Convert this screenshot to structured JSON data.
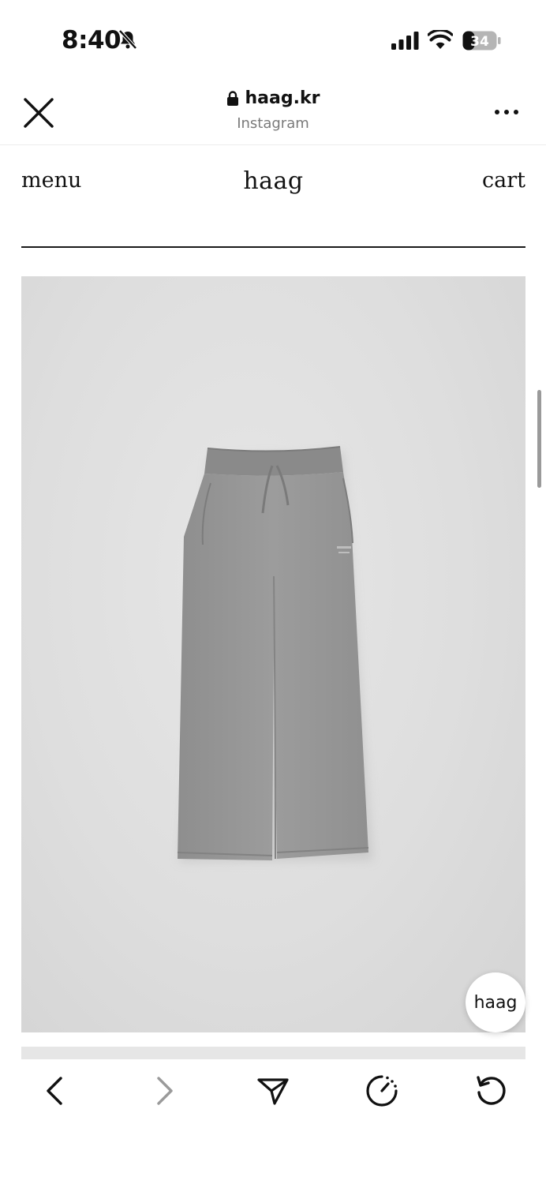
{
  "status_bar": {
    "time": "8:40",
    "battery": "34",
    "icons": [
      "bell-slash-icon",
      "cellular-signal-icon",
      "wifi-icon",
      "battery-icon"
    ]
  },
  "browser": {
    "domain": "haag.kr",
    "subtitle": "Instagram",
    "close_icon": "close-icon",
    "more_icon": "more-icon"
  },
  "site_nav": {
    "menu_label": "menu",
    "logo": "haag",
    "cart_label": "cart"
  },
  "product": {
    "image_alt": "grey sweatpants product photo"
  },
  "floating_button": {
    "label": "haag"
  },
  "toolbar": {
    "items": [
      "back-icon",
      "forward-icon",
      "share-icon",
      "speed-icon",
      "reload-icon"
    ]
  }
}
